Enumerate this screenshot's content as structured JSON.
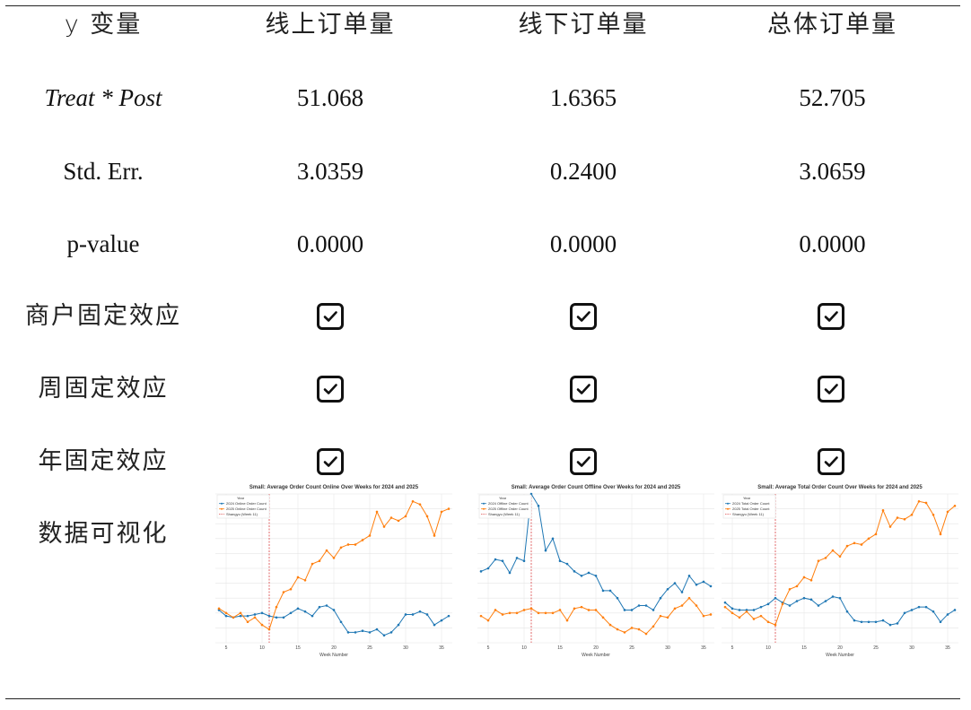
{
  "table": {
    "header": {
      "yvar": "y 变量",
      "col1": "线上订单量",
      "col2": "线下订单量",
      "col3": "总体订单量"
    },
    "rows": [
      {
        "label": "Treat * Post",
        "values": [
          "51.068",
          "1.6365",
          "52.705"
        ]
      },
      {
        "label": "Std. Err.",
        "values": [
          "3.0359",
          "0.2400",
          "3.0659"
        ]
      },
      {
        "label": "p-value",
        "values": [
          "0.0000",
          "0.0000",
          "0.0000"
        ]
      }
    ],
    "fe_rows": [
      {
        "label": "商户固定效应",
        "checked": [
          true,
          true,
          true
        ]
      },
      {
        "label": "周固定效应",
        "checked": [
          true,
          true,
          true
        ]
      },
      {
        "label": "年固定效应",
        "checked": [
          true,
          true,
          true
        ]
      }
    ],
    "viz_label": "数据可视化"
  },
  "colors": {
    "series_2024": "#1f77b4",
    "series_2025": "#ff7f0e",
    "shuangyu": "#d62728"
  },
  "chart_data": [
    {
      "type": "line",
      "title": "Small: Average Order Count Online Over Weeks for 2024 and 2025",
      "xlabel": "Week Number",
      "ylabel": "",
      "legend_title": "Year",
      "x": [
        4,
        5,
        6,
        7,
        8,
        9,
        10,
        11,
        12,
        13,
        14,
        15,
        16,
        17,
        18,
        19,
        20,
        21,
        22,
        23,
        24,
        25,
        26,
        27,
        28,
        29,
        30,
        31,
        32,
        33,
        34,
        35,
        36
      ],
      "xticks": [
        5,
        10,
        15,
        20,
        25,
        30,
        35
      ],
      "xlim": [
        3.5,
        36.5
      ],
      "ylim": [
        0,
        100
      ],
      "vline": {
        "x": 11,
        "name": "Shangyu (Week 11)"
      },
      "series": [
        {
          "name": "2024 Online Order Count",
          "values": [
            22,
            18,
            17,
            18,
            18,
            19,
            20,
            18,
            17,
            17,
            20,
            23,
            21,
            18,
            24,
            25,
            22,
            14,
            7,
            7,
            8,
            7,
            9,
            5,
            7,
            12,
            19,
            19,
            21,
            19,
            12,
            15,
            18
          ]
        },
        {
          "name": "2025 Online Order Count",
          "values": [
            23,
            20,
            17,
            20,
            14,
            17,
            12,
            9,
            24,
            34,
            36,
            44,
            42,
            53,
            55,
            62,
            57,
            64,
            66,
            66,
            69,
            72,
            88,
            78,
            84,
            82,
            85,
            95,
            93,
            85,
            72,
            88,
            90
          ]
        }
      ]
    },
    {
      "type": "line",
      "title": "Small: Average Order Count Offline Over Weeks for 2024 and 2025",
      "xlabel": "Week Number",
      "ylabel": "",
      "legend_title": "Year",
      "x": [
        4,
        5,
        6,
        7,
        8,
        9,
        10,
        11,
        12,
        13,
        14,
        15,
        16,
        17,
        18,
        19,
        20,
        21,
        22,
        23,
        24,
        25,
        26,
        27,
        28,
        29,
        30,
        31,
        32,
        33,
        34,
        35,
        36
      ],
      "xticks": [
        5,
        10,
        15,
        20,
        25,
        30,
        35
      ],
      "xlim": [
        3.5,
        36.5
      ],
      "ylim": [
        0,
        100
      ],
      "vline": {
        "x": 11,
        "name": "Shangyu (Week 11)"
      },
      "series": [
        {
          "name": "2024 Offline Order Count",
          "values": [
            48,
            50,
            56,
            55,
            47,
            57,
            55,
            100,
            92,
            62,
            70,
            55,
            53,
            48,
            45,
            47,
            45,
            35,
            35,
            30,
            22,
            22,
            25,
            25,
            22,
            30,
            36,
            40,
            34,
            45,
            39,
            41,
            38
          ]
        },
        {
          "name": "2025 Offline Order Count",
          "values": [
            18,
            15,
            22,
            19,
            20,
            20,
            22,
            23,
            20,
            20,
            20,
            22,
            15,
            23,
            24,
            22,
            22,
            17,
            12,
            9,
            7,
            10,
            9,
            6,
            11,
            18,
            17,
            23,
            25,
            30,
            25,
            18,
            19
          ]
        }
      ]
    },
    {
      "type": "line",
      "title": "Small: Average Total Order Count Over Weeks for 2024 and 2025",
      "xlabel": "Week Number",
      "ylabel": "",
      "legend_title": "Year",
      "x": [
        4,
        5,
        6,
        7,
        8,
        9,
        10,
        11,
        12,
        13,
        14,
        15,
        16,
        17,
        18,
        19,
        20,
        21,
        22,
        23,
        24,
        25,
        26,
        27,
        28,
        29,
        30,
        31,
        32,
        33,
        34,
        35,
        36
      ],
      "xticks": [
        5,
        10,
        15,
        20,
        25,
        30,
        35
      ],
      "xlim": [
        3.5,
        36.5
      ],
      "ylim": [
        0,
        100
      ],
      "vline": {
        "x": 11,
        "name": "Shangyu (Week 11)"
      },
      "series": [
        {
          "name": "2024 Total Order Count",
          "values": [
            27,
            23,
            22,
            22,
            22,
            24,
            26,
            30,
            27,
            25,
            28,
            30,
            29,
            25,
            28,
            31,
            30,
            21,
            15,
            14,
            14,
            14,
            15,
            12,
            13,
            20,
            22,
            24,
            24,
            21,
            14,
            19,
            22
          ]
        },
        {
          "name": "2025 Total Order Count",
          "values": [
            24,
            20,
            17,
            21,
            16,
            18,
            14,
            12,
            26,
            36,
            38,
            44,
            42,
            55,
            57,
            62,
            58,
            65,
            67,
            66,
            70,
            73,
            89,
            78,
            84,
            83,
            86,
            95,
            94,
            86,
            73,
            88,
            92
          ]
        }
      ]
    }
  ]
}
